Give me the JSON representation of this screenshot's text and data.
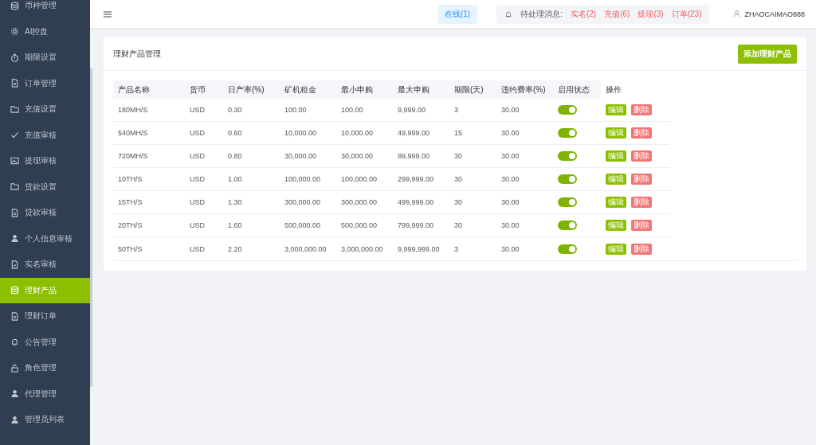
{
  "sidebar": {
    "items": [
      {
        "label": "币种管理",
        "selected": false
      },
      {
        "label": "AI控盘",
        "selected": false
      },
      {
        "label": "期限设置",
        "selected": false
      },
      {
        "label": "订单管理",
        "selected": false
      },
      {
        "label": "充值设置",
        "selected": false
      },
      {
        "label": "充值审核",
        "selected": false
      },
      {
        "label": "提现审核",
        "selected": false
      },
      {
        "label": "贷款设置",
        "selected": false
      },
      {
        "label": "贷款审核",
        "selected": false
      },
      {
        "label": "个人信息审核",
        "selected": false
      },
      {
        "label": "实名审核",
        "selected": false
      },
      {
        "label": "理财产品",
        "selected": true
      },
      {
        "label": "理财订单",
        "selected": false
      },
      {
        "label": "公告管理",
        "selected": false
      },
      {
        "label": "角色管理",
        "selected": false
      },
      {
        "label": "代理管理",
        "selected": false
      },
      {
        "label": "管理员列表",
        "selected": false
      }
    ]
  },
  "topbar": {
    "online": "在线(1)",
    "pending_label": "待处理消息:",
    "pending": [
      "实名(2)",
      "充值(6)",
      "提现(3)",
      "订单(23)"
    ],
    "user": "ZHAOCAIMAO888"
  },
  "card": {
    "title": "理财产品管理",
    "add_button": "添加理财产品"
  },
  "table": {
    "columns": [
      "产品名称",
      "货币",
      "日产率(%)",
      "矿机租金",
      "最小申购",
      "最大申购",
      "期限(天)",
      "违约费率(%)",
      "启用状态",
      "操作"
    ],
    "rows": [
      {
        "cells": [
          "180MH/S",
          "USD",
          "0.30",
          "100.00",
          "100.00",
          "9,999.00",
          "3",
          "30.00"
        ],
        "on": true,
        "actions": [
          "编辑",
          "删除"
        ]
      },
      {
        "cells": [
          "540MH/S",
          "USD",
          "0.60",
          "10,000.00",
          "10,000.00",
          "49,999.00",
          "15",
          "30.00"
        ],
        "on": true,
        "actions": [
          "编辑",
          "删除"
        ]
      },
      {
        "cells": [
          "720MH/S",
          "USD",
          "0.80",
          "30,000.00",
          "30,000.00",
          "99,999.00",
          "30",
          "30.00"
        ],
        "on": true,
        "actions": [
          "编辑",
          "删除"
        ]
      },
      {
        "cells": [
          "10TH/S",
          "USD",
          "1.00",
          "100,000.00",
          "100,000.00",
          "299,999.00",
          "30",
          "30.00"
        ],
        "on": true,
        "actions": [
          "编辑",
          "删除"
        ]
      },
      {
        "cells": [
          "15TH/S",
          "USD",
          "1.30",
          "300,000.00",
          "300,000.00",
          "499,999.00",
          "30",
          "30.00"
        ],
        "on": true,
        "actions": [
          "编辑",
          "删除"
        ]
      },
      {
        "cells": [
          "20TH/S",
          "USD",
          "1.60",
          "500,000.00",
          "500,000.00",
          "799,999.00",
          "30",
          "30.00"
        ],
        "on": true,
        "actions": [
          "编辑",
          "删除"
        ]
      },
      {
        "cells": [
          "50TH/S",
          "USD",
          "2.20",
          "3,000,000.00",
          "3,000,000.00",
          "9,999,999.00",
          "3",
          "30.00"
        ],
        "on": true,
        "actions": [
          "编辑",
          "删除"
        ]
      }
    ]
  }
}
